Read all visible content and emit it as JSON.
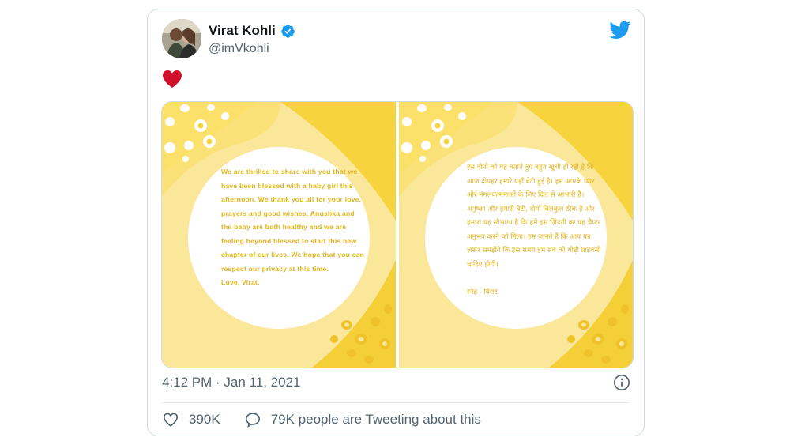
{
  "tweet": {
    "author_name": "Virat Kohli",
    "handle": "@imVkohli",
    "verified_icon": "verified-badge-icon",
    "body_emoji": "heart-emoji",
    "timestamp": "4:12 PM · Jan 11, 2021",
    "likes": "390K",
    "tweeting_text": "79K people are Tweeting about this"
  },
  "media": {
    "english_note": [
      "We are thrilled to share with you that we",
      "have been blessed with a baby girl this",
      "afternoon. We thank you all for your love,",
      "prayers and good wishes. Anushka and",
      "the baby are both healthy and we are",
      "feeling beyond blessed to start this new",
      "chapter of our lives. We hope that you can",
      "respect our privacy at this time.",
      "Love, Virat."
    ],
    "hindi_note": [
      "हम दोनों को यह बताते हुए बहुत खुशी हो रही है कि",
      "आज दोपहर हमारे यहाँ बेटी हुई है। हम आपके प्यार",
      "और मंगलकामनाओं के लिए दिल से आभारी हैं।",
      "अनुष्का और हमारी बेटी, दोनों बिलकुल ठीक हैं और",
      "हमारा यह सौभाग्य है कि हमें इस ज़िंदगी का यह चैप्टर",
      "अनुभव करने को मिला। हम जानते हैं कि आप यह",
      "ज़रूर समझेंगे कि इस समय हम सब को थोड़ी प्राइवसी",
      "चाहिए होगी।",
      "",
      "स्नेह - विराट"
    ]
  },
  "colors": {
    "text_primary": "#0f1419",
    "text_secondary": "#536471",
    "twitter_blue": "#1d9bf0",
    "heart_red": "#d0102a",
    "panel_yellow": "#f9e27a",
    "panel_text": "#e2b51d"
  }
}
